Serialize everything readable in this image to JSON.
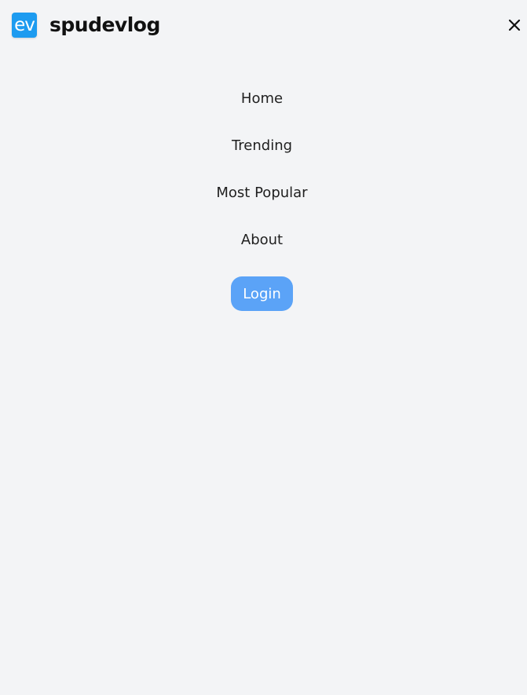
{
  "header": {
    "logo_text": "ev",
    "brand": "spudevlog",
    "close_icon": "close-icon",
    "accent_color": "#1d9bf0"
  },
  "nav": {
    "items": [
      {
        "label": "Home"
      },
      {
        "label": "Trending"
      },
      {
        "label": "Most Popular"
      },
      {
        "label": "About"
      }
    ],
    "login_label": "Login",
    "login_color": "#5ba3f7"
  }
}
